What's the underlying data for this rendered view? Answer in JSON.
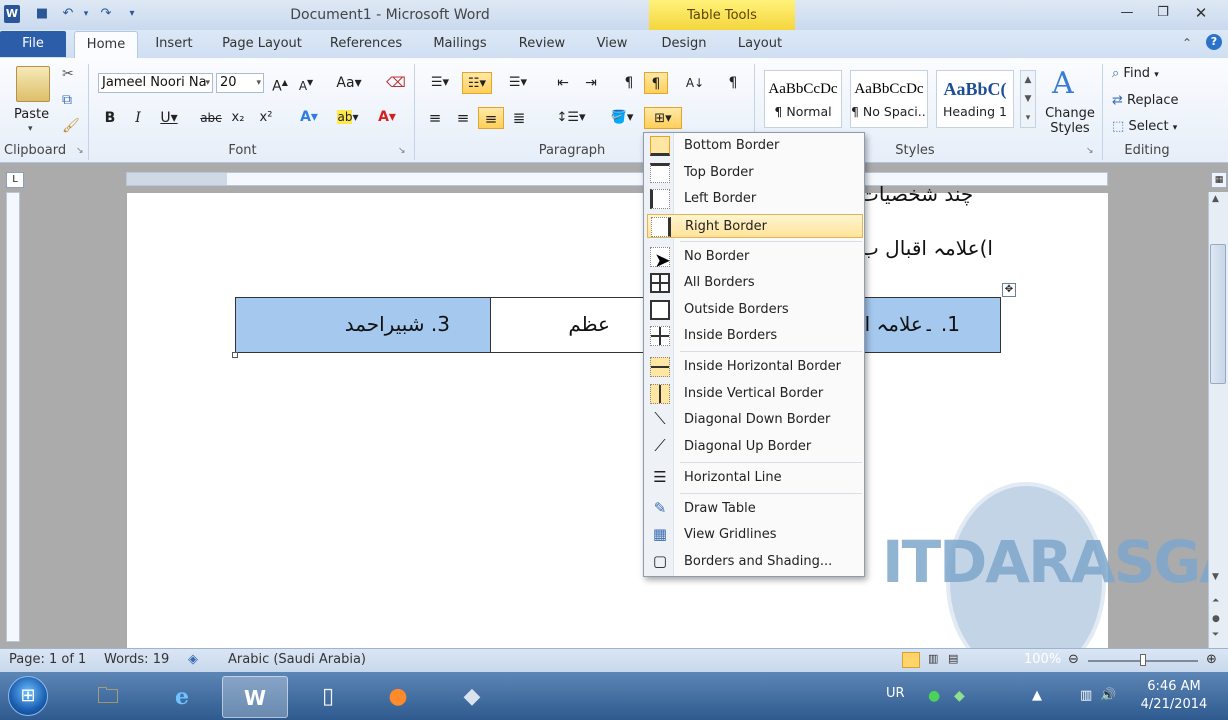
{
  "window": {
    "title": "Document1  -  Microsoft Word",
    "context_tab": "Table Tools"
  },
  "tabs": [
    "File",
    "Home",
    "Insert",
    "Page Layout",
    "References",
    "Mailings",
    "Review",
    "View",
    "Design",
    "Layout"
  ],
  "ribbon": {
    "clipboard": {
      "label": "Clipboard",
      "paste": "Paste"
    },
    "font": {
      "label": "Font",
      "name": "Jameel Noori Na",
      "size": "20"
    },
    "paragraph": {
      "label": "Paragraph"
    },
    "styles": {
      "label": "Styles",
      "items": [
        {
          "sample": "AaBbCcDc",
          "name": "¶ Normal"
        },
        {
          "sample": "AaBbCcDc",
          "name": "¶ No Spaci..."
        },
        {
          "sample": "AaBbC(",
          "name": "Heading 1"
        }
      ],
      "change_styles": "Change Styles"
    },
    "editing": {
      "label": "Editing",
      "find": "Find",
      "replace": "Replace",
      "select": "Select"
    }
  },
  "document": {
    "line1": "چند شخصیات",
    "line2": "ا)علامہ اقبال ب",
    "table": {
      "cell1": "3. شبیراحمد",
      "cell2": "عظم",
      "cell3": "1. ۔علامہ اق"
    }
  },
  "border_menu": {
    "items": [
      "Bottom Border",
      "Top Border",
      "Left Border",
      "Right Border",
      "No Border",
      "All Borders",
      "Outside Borders",
      "Inside Borders",
      "Inside Horizontal Border",
      "Inside Vertical Border",
      "Diagonal Down Border",
      "Diagonal Up Border",
      "Horizontal Line",
      "Draw Table",
      "View Gridlines",
      "Borders and Shading..."
    ],
    "selected": "Right Border"
  },
  "status": {
    "page": "Page: 1 of 1",
    "words": "Words: 19",
    "language": "Arabic (Saudi Arabia)",
    "zoom": "100%"
  },
  "taskbar": {
    "lang": "UR",
    "time": "6:46 AM",
    "date": "4/21/2014"
  },
  "watermark": {
    "text": "ITDARASGAH"
  },
  "colors": {
    "accent": "#2b5da8",
    "highlight": "#ffcf5a",
    "table_fill": "#a5c8ee",
    "context_tab": "#f4d43a"
  }
}
